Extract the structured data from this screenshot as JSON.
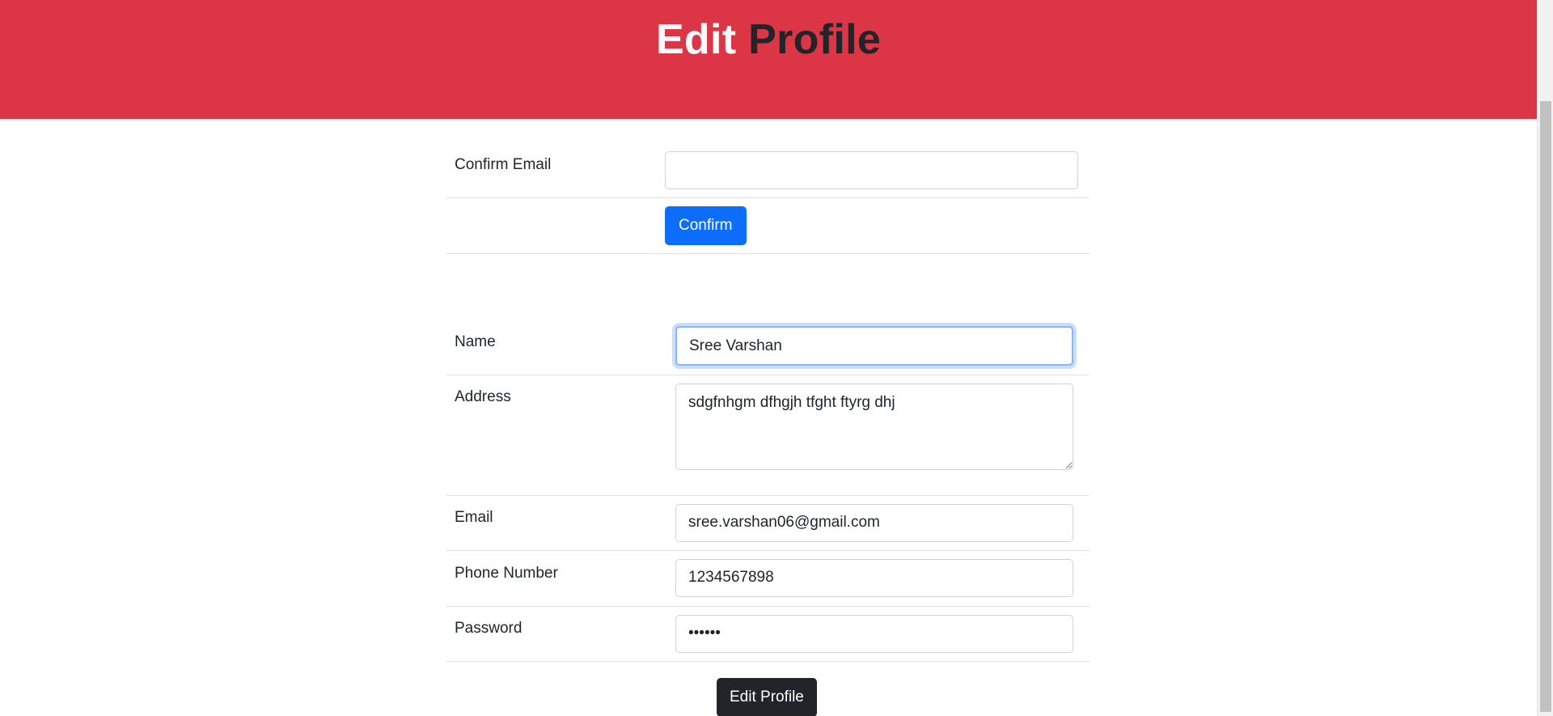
{
  "header": {
    "title_part1": "Edit",
    "title_part2": "Profile",
    "background": "#dc3545"
  },
  "confirm_form": {
    "email_label": "Confirm Email",
    "email_value": "",
    "confirm_button": "Confirm"
  },
  "profile_form": {
    "name_label": "Name",
    "name_value": "Sree Varshan",
    "address_label": "Address",
    "address_value": "sdgfnhgm dfhgjh tfght ftyrg dhj",
    "email_label": "Email",
    "email_value": "sree.varshan06@gmail.com",
    "phone_label": "Phone Number",
    "phone_value": "1234567898",
    "password_label": "Password",
    "password_value": "......",
    "submit_button": "Edit Profile"
  },
  "colors": {
    "primary": "#0d6efd",
    "dark": "#212529",
    "focus": "#86b7fe"
  }
}
